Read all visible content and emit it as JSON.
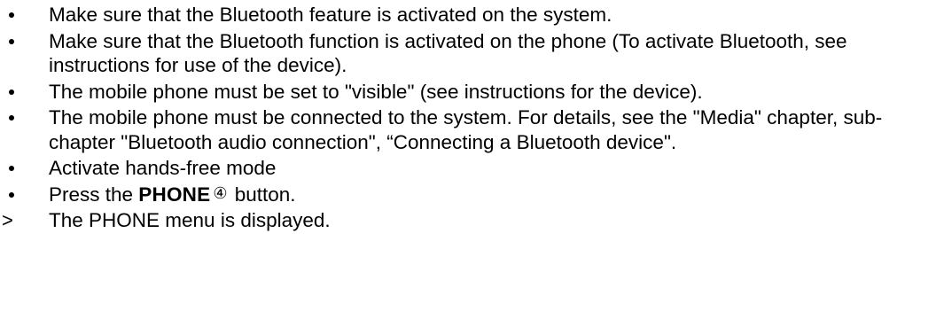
{
  "items": [
    {
      "text": "Make sure that the Bluetooth feature is activated on the system."
    },
    {
      "text": "Make sure that the Bluetooth function is activated on the phone (To activate Bluetooth, see instructions for use of the device)."
    },
    {
      "text": "The mobile phone must be set to \"visible\" (see instructions for the device)."
    },
    {
      "text": "The mobile phone must be connected to the system. For details, see the \"Media\" chapter, sub-chapter \"Bluetooth audio connection\", “Connecting a Bluetooth device\"."
    },
    {
      "text": "Activate hands-free mode"
    },
    {
      "before": "Press the ",
      "bold": "PHONE",
      "circled": "④",
      "after": " button."
    }
  ],
  "result": {
    "marker": ">",
    "text": "The PHONE menu is displayed."
  }
}
